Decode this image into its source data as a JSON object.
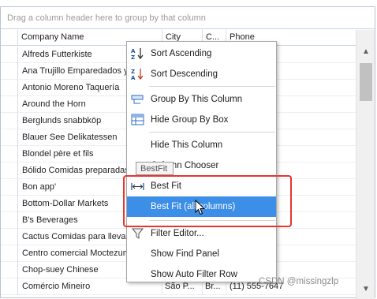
{
  "group_panel": {
    "hint": "Drag a column header here to group by that column"
  },
  "columns": [
    {
      "label": "Company Name"
    },
    {
      "label": "City"
    },
    {
      "label": "C..."
    },
    {
      "label": "Phone"
    }
  ],
  "rows": [
    {
      "company": "Alfreds Futterkiste",
      "city": "",
      "country": "",
      "phone": "1"
    },
    {
      "company": "Ana Trujillo Emparedados y helados",
      "city": "",
      "country": "",
      "phone": "9"
    },
    {
      "company": "Antonio Moreno Taquería",
      "city": "",
      "country": "",
      "phone": ""
    },
    {
      "company": "Around the Horn",
      "city": "",
      "country": "",
      "phone": "788"
    },
    {
      "company": "Berglunds snabbköp",
      "city": "",
      "country": "",
      "phone": "55"
    },
    {
      "company": "Blauer See Delikatessen",
      "city": "",
      "country": "",
      "phone": ""
    },
    {
      "company": "Blondel père et fils",
      "city": "",
      "country": "",
      "phone": ""
    },
    {
      "company": "Bólido Comidas preparadas",
      "city": "",
      "country": "",
      "phone": "82"
    },
    {
      "company": "Bon app'",
      "city": "",
      "country": "",
      "phone": ""
    },
    {
      "company": "Bottom-Dollar Markets",
      "city": "",
      "country": "",
      "phone": "729"
    },
    {
      "company": "B's Beverages",
      "city": "",
      "country": "",
      "phone": "212"
    },
    {
      "company": "Cactus Comidas para llevar",
      "city": "",
      "country": "",
      "phone": "5"
    },
    {
      "company": "Centro comercial Moctezuma",
      "city": "",
      "country": "",
      "phone": ""
    },
    {
      "company": "Chop-suey Chinese",
      "city": "",
      "country": "",
      "phone": ""
    },
    {
      "company": "Comércio Mineiro",
      "city": "São P...",
      "country": "Br...",
      "phone": "(11) 555-7647"
    }
  ],
  "context_menu": {
    "items": [
      {
        "label": "Sort Ascending",
        "icon": "sort-ascending-icon"
      },
      {
        "label": "Sort Descending",
        "icon": "sort-descending-icon"
      },
      {
        "label": "Group By This Column",
        "icon": "group-by-column-icon"
      },
      {
        "label": "Hide Group By Box",
        "icon": "group-box-icon"
      },
      {
        "label": "Hide This Column",
        "icon": ""
      },
      {
        "label": "Column Chooser",
        "icon": "column-chooser-icon"
      },
      {
        "label": "Best Fit",
        "icon": "best-fit-icon"
      },
      {
        "label": "Best Fit (all columns)",
        "icon": ""
      },
      {
        "label": "Filter Editor...",
        "icon": "filter-icon"
      },
      {
        "label": "Show Find Panel",
        "icon": ""
      },
      {
        "label": "Show Auto Filter Row",
        "icon": ""
      }
    ],
    "highlighted": "Best Fit (all columns)"
  },
  "tooltip": {
    "text": "BestFit"
  },
  "watermark": {
    "text": "CSDN @missingzlp"
  },
  "colors": {
    "accent": "#3c8ee6",
    "highlight_border": "#e8352d",
    "grid_border": "#b9c4d2"
  }
}
